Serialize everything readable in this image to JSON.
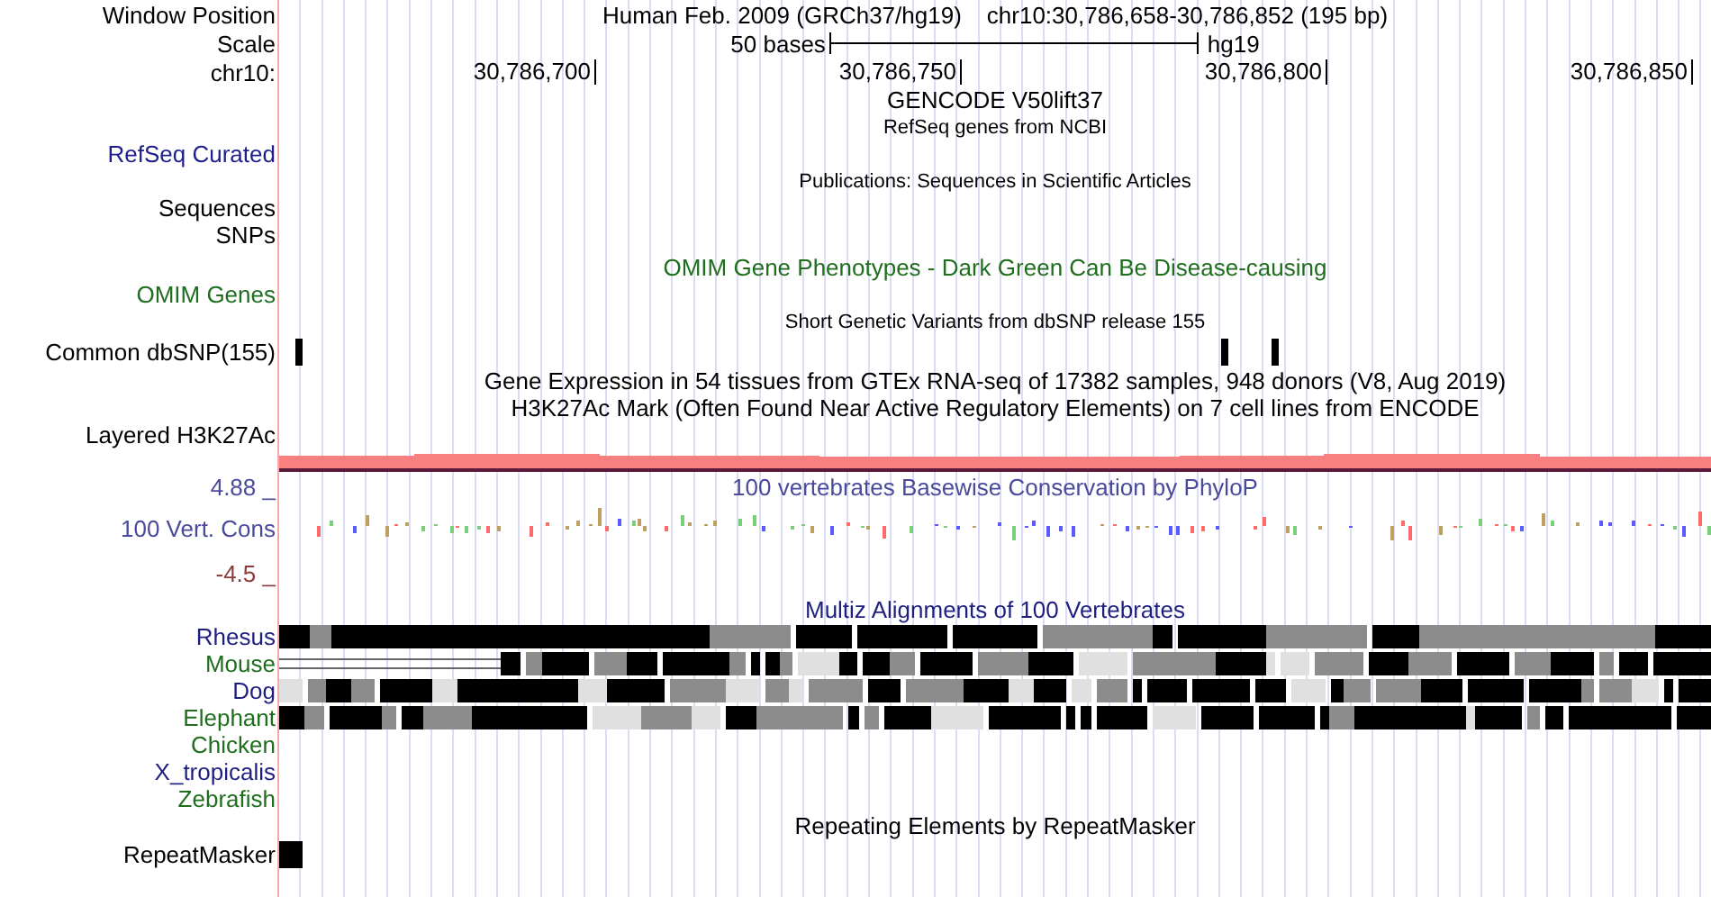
{
  "position": {
    "label": "Window Position",
    "assembly": "Human Feb. 2009 (GRCh37/hg19)",
    "range": "chr10:30,786,658-30,786,852 (195 bp)"
  },
  "scale": {
    "label": "Scale",
    "length": "50 bases",
    "assembly": "hg19"
  },
  "ruler": {
    "label": "chr10:",
    "ticks": [
      "30,786,700",
      "30,786,750",
      "30,786,800",
      "30,786,850"
    ]
  },
  "rows": [
    {
      "kind": "title",
      "text": "GENCODE V50lift37",
      "color": "#000000"
    },
    {
      "kind": "caption",
      "text": "RefSeq genes from NCBI",
      "color": "#000000"
    },
    {
      "kind": "label",
      "label": "RefSeq Curated",
      "color": "#1e1e8c"
    },
    {
      "kind": "caption",
      "text": "Publications: Sequences in Scientific Articles",
      "color": "#000000"
    },
    {
      "kind": "label",
      "label": "Sequences",
      "color": "#000000"
    },
    {
      "kind": "label",
      "label": "SNPs",
      "color": "#000000"
    },
    {
      "kind": "title",
      "text": "OMIM Gene Phenotypes - Dark Green Can Be Disease-causing",
      "color": "#1e6e1e"
    },
    {
      "kind": "label",
      "label": "OMIM Genes",
      "color": "#1e6e1e"
    },
    {
      "kind": "caption",
      "text": "Short Genetic Variants from dbSNP release 155",
      "color": "#000000"
    },
    {
      "kind": "variants",
      "label": "Common dbSNP(155)",
      "color": "#000000"
    },
    {
      "kind": "title",
      "text": "Gene Expression in 54 tissues from GTEx RNA-seq of 17382 samples, 948 donors (V8, Aug 2019)",
      "color": "#000000"
    },
    {
      "kind": "title",
      "text": "H3K27Ac Mark (Often Found Near Active Regulatory Elements) on 7 cell lines from ENCODE",
      "color": "#000000"
    },
    {
      "kind": "label",
      "label": "Layered H3K27Ac",
      "color": "#000000"
    },
    {
      "kind": "signal"
    },
    {
      "kind": "title",
      "text": "100 vertebrates Basewise Conservation by PhyloP",
      "color": "#4a4a9c",
      "label": "4.88 _"
    },
    {
      "kind": "conservation",
      "label": "100 Vert. Cons",
      "color": "#4a4a9c"
    },
    {
      "kind": "label",
      "label": "-4.5 _",
      "color": "#8c3a3a"
    },
    {
      "kind": "title",
      "text": "Multiz Alignments of 100 Vertebrates",
      "color": "#1e1e80"
    },
    {
      "kind": "species",
      "label": "Rhesus",
      "color": "#1e1e80",
      "aligned": true
    },
    {
      "kind": "species",
      "label": "Mouse",
      "color": "#1e6e1e",
      "aligned": true
    },
    {
      "kind": "species",
      "label": "Dog",
      "color": "#1e1e80",
      "aligned": true
    },
    {
      "kind": "species",
      "label": "Elephant",
      "color": "#1e6e1e",
      "aligned": true
    },
    {
      "kind": "species",
      "label": "Chicken",
      "color": "#1e6e1e",
      "aligned": false
    },
    {
      "kind": "species",
      "label": "X_tropicalis",
      "color": "#1e1e80",
      "aligned": false
    },
    {
      "kind": "species",
      "label": "Zebrafish",
      "color": "#1e6e1e",
      "aligned": false
    },
    {
      "kind": "title",
      "text": "Repeating Elements by RepeatMasker",
      "color": "#000000"
    },
    {
      "kind": "repeat",
      "label": "RepeatMasker",
      "color": "#000000"
    }
  ]
}
